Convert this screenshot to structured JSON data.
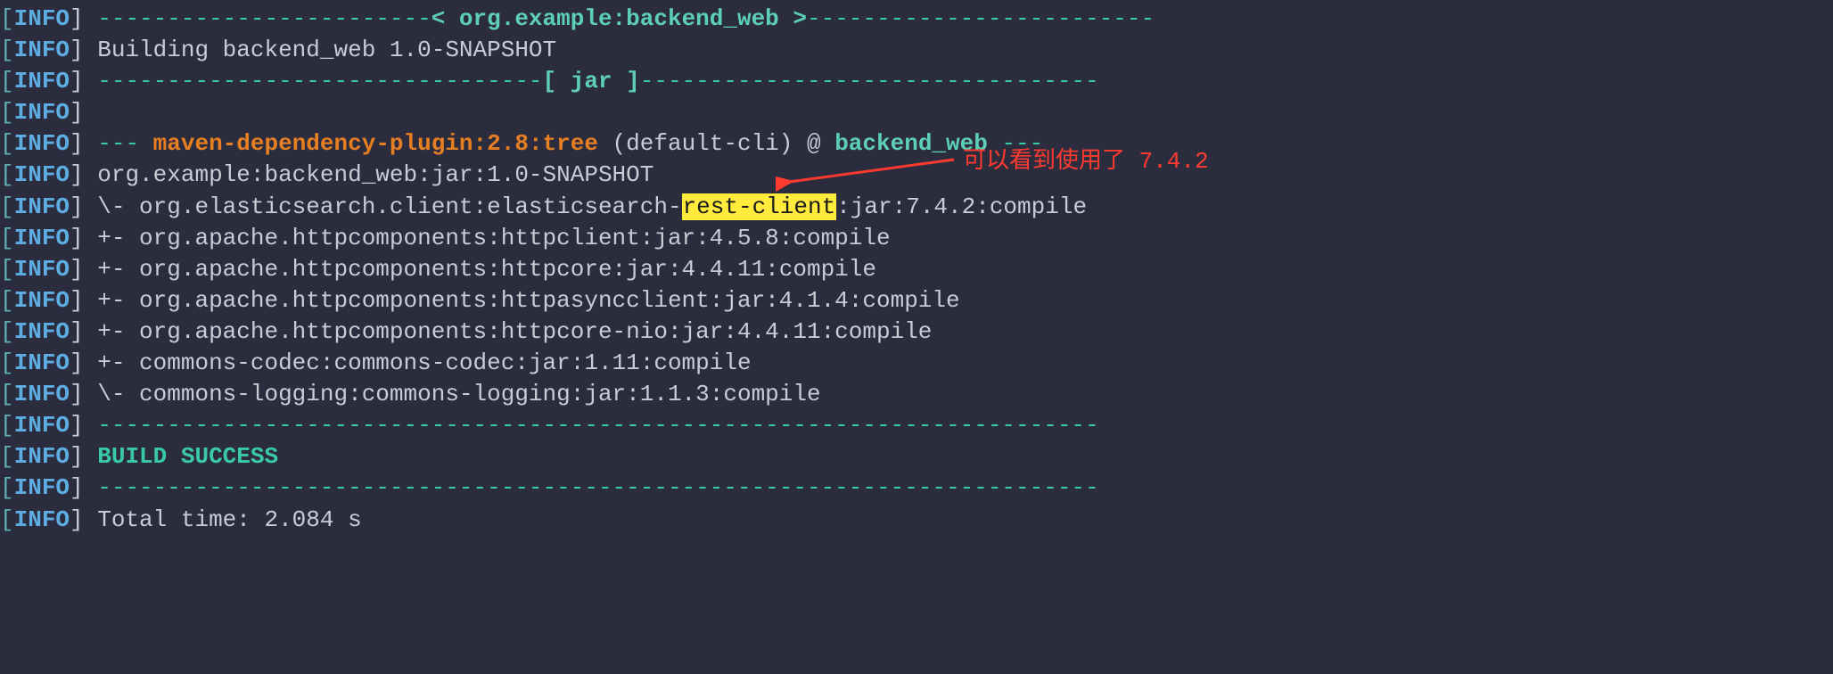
{
  "prefix": {
    "open": "[",
    "tag": "INFO",
    "close": "]"
  },
  "lines": {
    "l0": {
      "dash_pre": "------------------------",
      "label": "< org.example:backend_web >",
      "dash_post": "-------------------------"
    },
    "l1": "Building backend_web 1.0-SNAPSHOT",
    "l2": {
      "dash_pre": "--------------------------------",
      "label": "[ jar ]",
      "dash_post": "---------------------------------"
    },
    "l4": {
      "dash_pre": "--- ",
      "plugin": "maven-dependency-plugin:2.8:tree",
      "context": " (default-cli) @ ",
      "module": "backend_web",
      "dash_post": " ---"
    },
    "l5": "org.example:backend_web:jar:1.0-SNAPSHOT",
    "l6": {
      "pre": "\\- org.elasticsearch.client:elasticsearch-",
      "highlight": "rest-client",
      "post": ":jar:7.4.2:compile"
    },
    "l7": "   +- org.apache.httpcomponents:httpclient:jar:4.5.8:compile",
    "l8": "   +- org.apache.httpcomponents:httpcore:jar:4.4.11:compile",
    "l9": "   +- org.apache.httpcomponents:httpasyncclient:jar:4.1.4:compile",
    "l10": "   +- org.apache.httpcomponents:httpcore-nio:jar:4.4.11:compile",
    "l11": "   +- commons-codec:commons-codec:jar:1.11:compile",
    "l12": "   \\- commons-logging:commons-logging:jar:1.1.3:compile",
    "l13": "------------------------------------------------------------------------",
    "l14": "BUILD SUCCESS",
    "l15": "------------------------------------------------------------------------",
    "l16": "Total time:  2.084 s"
  },
  "annotation": {
    "text": "可以看到使用了 7.4.2"
  }
}
